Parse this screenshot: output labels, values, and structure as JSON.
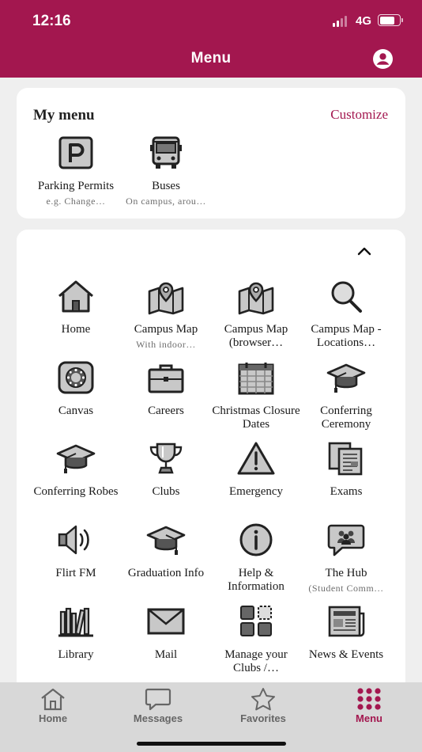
{
  "status_bar": {
    "time": "12:16",
    "network": "4G"
  },
  "header": {
    "title": "Menu",
    "profile_icon": "account-circle-icon"
  },
  "colors": {
    "brand": "#a3174f",
    "card": "#ffffff",
    "background": "#efefef",
    "tabbar": "#d8d8d8"
  },
  "my_menu": {
    "title": "My menu",
    "customize_label": "Customize",
    "items": [
      {
        "label": "Parking Permits",
        "sub": "e.g. Change…",
        "icon": "parking-icon"
      },
      {
        "label": "Buses",
        "sub": "On campus, arou…",
        "icon": "bus-icon"
      }
    ]
  },
  "grid": {
    "items": [
      {
        "label": "Home",
        "sub": "",
        "icon": "home-icon"
      },
      {
        "label": "Campus Map",
        "sub": "With indoor…",
        "icon": "map-pin-icon"
      },
      {
        "label": "Campus Map (browser…",
        "sub": "",
        "icon": "map-pin-icon"
      },
      {
        "label": "Campus Map - Locations…",
        "sub": "",
        "icon": "magnifier-icon"
      },
      {
        "label": "Canvas",
        "sub": "",
        "icon": "canvas-icon"
      },
      {
        "label": "Careers",
        "sub": "",
        "icon": "briefcase-icon"
      },
      {
        "label": "Christmas Closure Dates",
        "sub": "",
        "icon": "calendar-icon"
      },
      {
        "label": "Conferring Ceremony",
        "sub": "",
        "icon": "mortarboard-icon"
      },
      {
        "label": "Conferring Robes",
        "sub": "",
        "icon": "mortarboard-icon"
      },
      {
        "label": "Clubs",
        "sub": "",
        "icon": "trophy-icon"
      },
      {
        "label": "Emergency",
        "sub": "",
        "icon": "warning-icon"
      },
      {
        "label": "Exams",
        "sub": "",
        "icon": "documents-icon"
      },
      {
        "label": "Flirt FM",
        "sub": "",
        "icon": "speaker-icon"
      },
      {
        "label": "Graduation Info",
        "sub": "",
        "icon": "mortarboard-icon"
      },
      {
        "label": "Help & Information",
        "sub": "",
        "icon": "info-icon"
      },
      {
        "label": "The Hub",
        "sub": "(Student Comm…",
        "icon": "chat-people-icon"
      },
      {
        "label": "Library",
        "sub": "",
        "icon": "books-icon"
      },
      {
        "label": "Mail",
        "sub": "",
        "icon": "envelope-icon"
      },
      {
        "label": "Manage your Clubs /…",
        "sub": "",
        "icon": "grid-manage-icon"
      },
      {
        "label": "News & Events",
        "sub": "",
        "icon": "newspaper-icon"
      }
    ]
  },
  "tabbar": {
    "tabs": [
      {
        "label": "Home",
        "icon": "home-outline-icon",
        "active": false
      },
      {
        "label": "Messages",
        "icon": "message-icon",
        "active": false
      },
      {
        "label": "Favorites",
        "icon": "star-icon",
        "active": false
      },
      {
        "label": "Menu",
        "icon": "dots-grid-icon",
        "active": true
      }
    ]
  }
}
